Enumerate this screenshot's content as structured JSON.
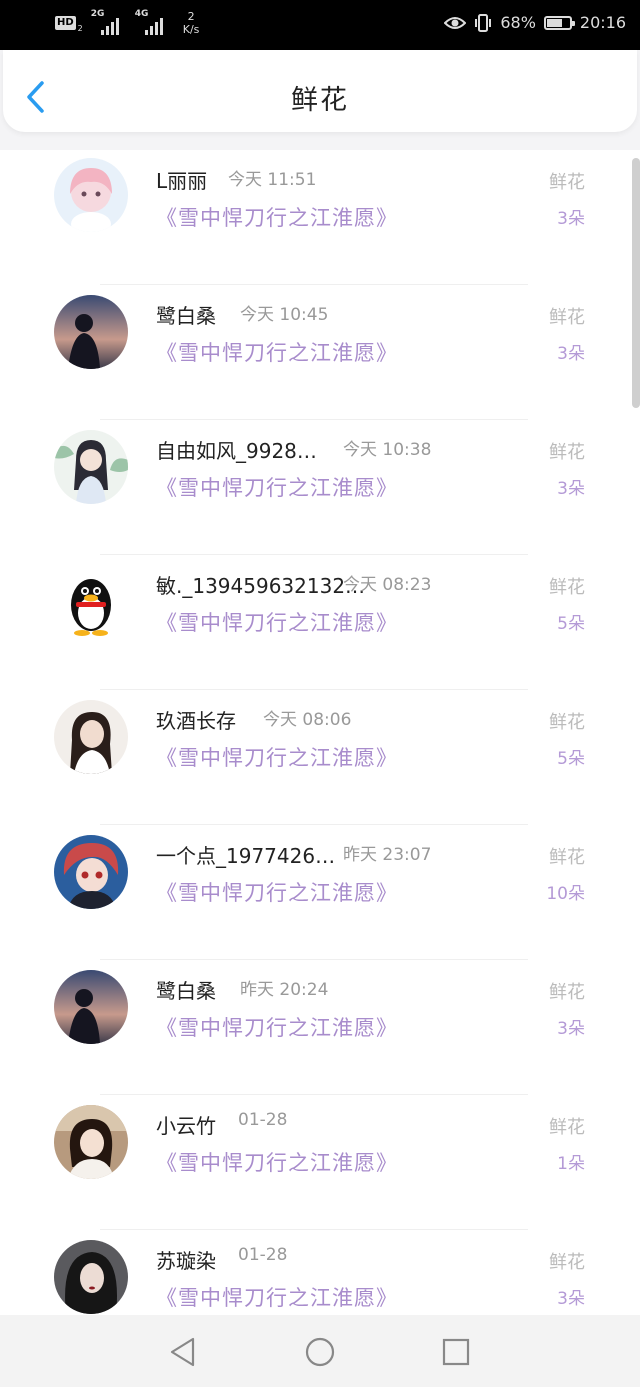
{
  "status_bar": {
    "hd": "HD",
    "hd_sub": "2",
    "net1": "2G",
    "net2": "4G",
    "speed_value": "2",
    "speed_unit": "K/s",
    "battery": "68%",
    "battery_level": 0.68,
    "time": "20:16"
  },
  "header": {
    "title": "鲜花"
  },
  "rows": [
    {
      "name": "L丽丽",
      "time": "今天 11:51",
      "book": "《雪中悍刀行之江淮愿》",
      "gift": "鲜花",
      "count": "3朵"
    },
    {
      "name": "鹭白桑",
      "time": "今天 10:45",
      "book": "《雪中悍刀行之江淮愿》",
      "gift": "鲜花",
      "count": "3朵"
    },
    {
      "name": "自由如风_9928…",
      "time": "今天 10:38",
      "book": "《雪中悍刀行之江淮愿》",
      "gift": "鲜花",
      "count": "3朵"
    },
    {
      "name": "敏._139459632132…",
      "time": "今天 08:23",
      "book": "《雪中悍刀行之江淮愿》",
      "gift": "鲜花",
      "count": "5朵"
    },
    {
      "name": "玖酒长存",
      "time": "今天 08:06",
      "book": "《雪中悍刀行之江淮愿》",
      "gift": "鲜花",
      "count": "5朵"
    },
    {
      "name": "一个点_1977426…",
      "time": "昨天 23:07",
      "book": "《雪中悍刀行之江淮愿》",
      "gift": "鲜花",
      "count": "10朵"
    },
    {
      "name": "鹭白桑",
      "time": "昨天 20:24",
      "book": "《雪中悍刀行之江淮愿》",
      "gift": "鲜花",
      "count": "3朵"
    },
    {
      "name": "小云竹",
      "time": "01-28",
      "book": "《雪中悍刀行之江淮愿》",
      "gift": "鲜花",
      "count": "1朵"
    },
    {
      "name": "苏璇染",
      "time": "01-28",
      "book": "《雪中悍刀行之江淮愿》",
      "gift": "鲜花",
      "count": "3朵"
    }
  ],
  "colors": {
    "accent": "#2a9cf0",
    "book": "#a88ccc",
    "count": "#b49ad6"
  }
}
